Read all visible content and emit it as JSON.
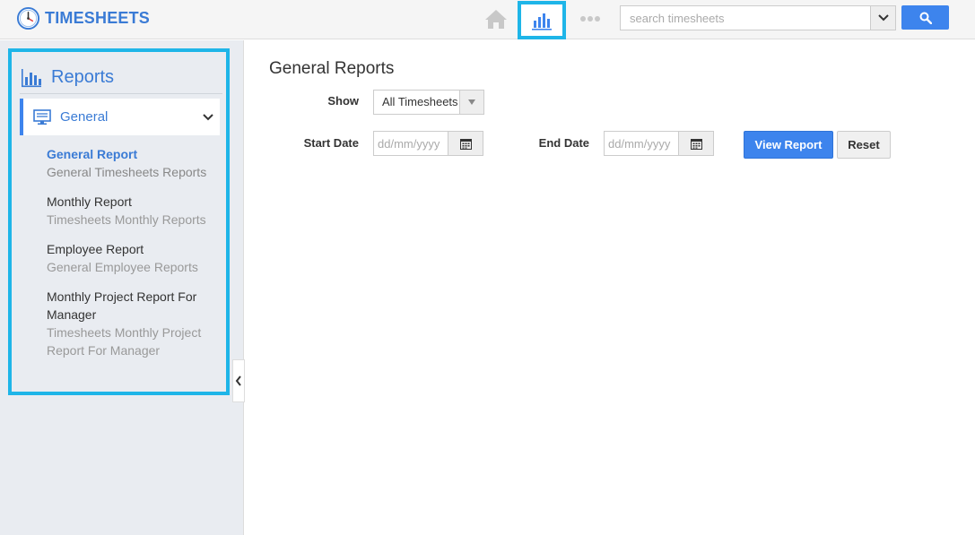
{
  "app": {
    "title": "TIMESHEETS",
    "logo_icon": "clock-icon"
  },
  "topnav": {
    "home_icon": "home-icon",
    "reports_icon": "bar-chart-icon",
    "more_icon": "more-dots-icon",
    "search_placeholder": "search timesheets",
    "search_dropdown_icon": "chevron-down-icon",
    "search_icon": "search-icon"
  },
  "sidebar": {
    "title": "Reports",
    "title_icon": "bar-chart-icon",
    "section": {
      "label": "General",
      "icon": "monitor-icon",
      "chevron_icon": "chevron-down-icon"
    },
    "items": [
      {
        "name": "General Report",
        "desc": "General Timesheets Reports"
      },
      {
        "name": "Monthly Report",
        "desc": "Timesheets Monthly Reports"
      },
      {
        "name": "Employee Report",
        "desc": "General Employee Reports"
      },
      {
        "name": "Monthly Project Report For Manager",
        "desc": "Timesheets Monthly Project Report For Manager"
      }
    ],
    "collapse_icon": "chevron-left-icon"
  },
  "main": {
    "title": "General Reports",
    "show_label": "Show",
    "show_value": "All Timesheets",
    "start_label": "Start Date",
    "end_label": "End Date",
    "date_placeholder": "dd/mm/yyyy",
    "calendar_icon": "calendar-icon",
    "view_button": "View Report",
    "reset_button": "Reset"
  },
  "colors": {
    "accent": "#3d84ed",
    "highlight": "#1eb5e8",
    "sidebar_bg": "#e9ecf1"
  }
}
